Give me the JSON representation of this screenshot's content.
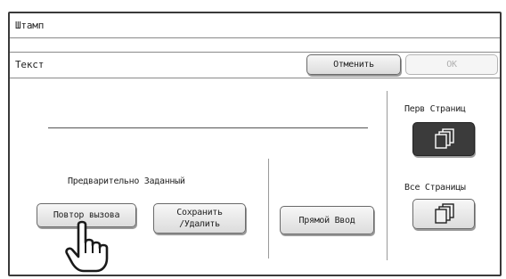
{
  "title_bar": {
    "title": "Штамп"
  },
  "sub_bar": {
    "label": "Текст",
    "cancel_label": "Отменить",
    "ok_label": "OK"
  },
  "main": {
    "preset_label": "Предварительно Заданный",
    "recall_label": "Повтор вызова",
    "save_delete_line1": "Сохранить",
    "save_delete_line2": "/Удалить",
    "direct_entry_label": "Прямой Ввод",
    "first_page_label": "Перв Страниц",
    "all_pages_label": "Все Страницы",
    "first_page_selected": true,
    "first_page_icon": "document-stack-icon",
    "all_pages_icon": "document-stack-icon",
    "pointer_icon": "hand-pointer-icon"
  }
}
